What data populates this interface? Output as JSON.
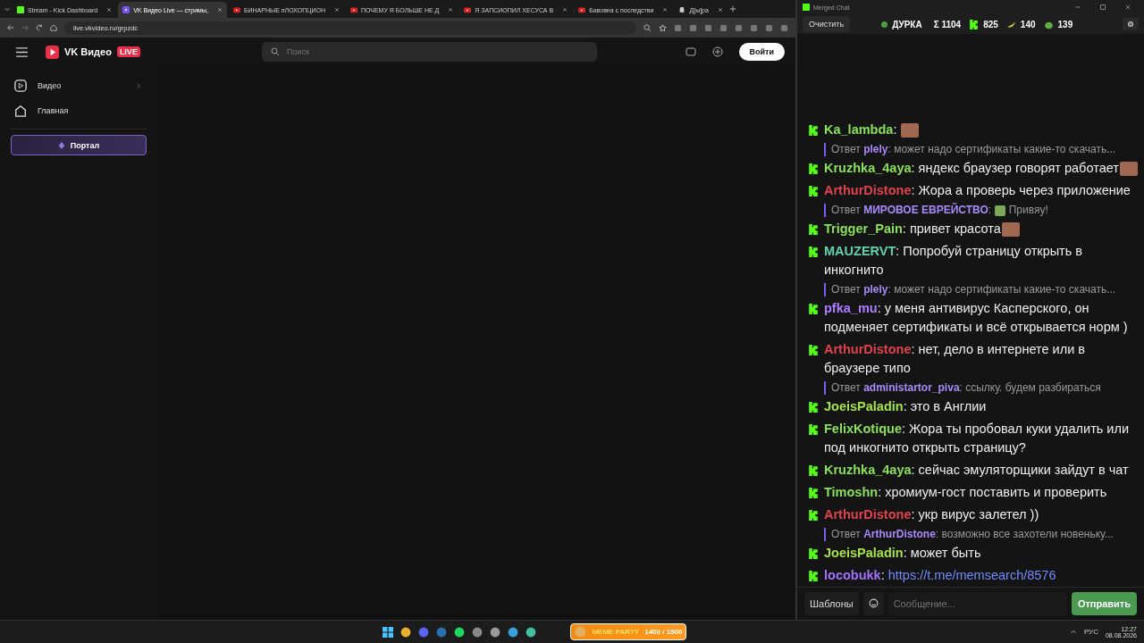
{
  "browser": {
    "tabs": [
      {
        "kind": "kick",
        "title": "Stream - Kick Dashboard",
        "selected": false
      },
      {
        "kind": "vk",
        "title": "VK Видео Live — стримы, ",
        "selected": true
      },
      {
        "kind": "youtube",
        "title": "БИНАРНЫЕ пЛОХОПЦИОН",
        "selected": false
      },
      {
        "kind": "youtube",
        "title": "ПОЧЕМУ Я БОЛЬШЕ НЕ Д",
        "selected": false
      },
      {
        "kind": "youtube",
        "title": "Я ЗАПСИОПИЛ ХЕСУСА В",
        "selected": false
      },
      {
        "kind": "youtube",
        "title": "Бавовна с последстви",
        "selected": false
      },
      {
        "kind": "ghost",
        "title": "Д[ы]ра",
        "selected": false
      }
    ],
    "url": "live.vkvideo.ru/grpzdc"
  },
  "site": {
    "logo_text": "VK Видео",
    "logo_badge": "LIVE",
    "search": {
      "placeholder": "Поиск"
    },
    "login": "Войти",
    "nav": [
      {
        "kind": "video",
        "label": "Видео",
        "expandable": true
      },
      {
        "kind": "home",
        "label": "Главная",
        "expandable": false
      }
    ],
    "portal": "Портал"
  },
  "chat": {
    "window_title": "Merged Chat",
    "clear": "Очистить",
    "channel": "ДУРКА",
    "stats": [
      {
        "kind": "sum",
        "value": "Σ 1104"
      },
      {
        "kind": "kick",
        "value": "825"
      },
      {
        "kind": "banana",
        "value": "140"
      },
      {
        "kind": "frog",
        "value": "139"
      }
    ],
    "messages": [
      {
        "kind": "message",
        "user": "Ka_lambda",
        "sep": ":",
        "color": "#8be05a",
        "emote": true
      },
      {
        "kind": "reply",
        "label": "Ответ",
        "user": "plely",
        "sep": ":",
        "color": "#a78bfa",
        "text": "может надо сертификаты какие-то скачать...",
        "emote": false
      },
      {
        "kind": "message",
        "user": "Kruzhka_4aya",
        "sep": ":",
        "color": "#8be05a",
        "text": "яндекс браузер говорят работает",
        "emote": true
      },
      {
        "kind": "message",
        "user": "ArthurDistone",
        "sep": ":",
        "color": "#e0434d",
        "text": "Жора а проверь через приложение",
        "emote": false
      },
      {
        "kind": "reply",
        "label": "Ответ",
        "user": "МИРОВОЕ ЕВРЕЙСТВО",
        "sep": ":",
        "color": "#a78bfa",
        "text": "Привяу!",
        "emote": true
      },
      {
        "kind": "message",
        "user": "Trigger_Pain",
        "sep": ":",
        "color": "#8be05a",
        "text": "привет красота",
        "emote": true
      },
      {
        "kind": "message",
        "user": "MAUZERVT",
        "sep": ":",
        "color": "#62cfae",
        "text": "Попробуй страницу открыть в инкогнито",
        "emote": false
      },
      {
        "kind": "reply",
        "label": "Ответ",
        "user": "plely",
        "sep": ":",
        "color": "#a78bfa",
        "text": "может надо сертификаты какие-то скачать...",
        "emote": false
      },
      {
        "kind": "message",
        "user": "pfka_mu",
        "sep": ":",
        "color": "#b07cff",
        "text": "у меня антивирус Касперского, он подменяет сертификаты и всё открывается норм )",
        "emote": false
      },
      {
        "kind": "message",
        "user": "ArthurDistone",
        "sep": ":",
        "color": "#e0434d",
        "text": "нет, дело в интернете или в браузере типо",
        "emote": false
      },
      {
        "kind": "reply",
        "label": "Ответ",
        "user": "administartor_piva",
        "sep": ":",
        "color": "#a78bfa",
        "text": "ссылку. будем разбираться",
        "emote": false
      },
      {
        "kind": "message",
        "user": "JoeisPaladin",
        "sep": ":",
        "color": "#a6e04e",
        "text": "это в Англии",
        "emote": false
      },
      {
        "kind": "message",
        "user": "FelixKotique",
        "sep": ":",
        "color": "#8be05a",
        "text": "Жора ты пробовал куки удалить или под инкогнито открыть страницу?",
        "emote": false
      },
      {
        "kind": "message",
        "user": "Kruzhka_4aya",
        "sep": ":",
        "color": "#8be05a",
        "text": "сейчас эмуляторщики зайдут в чат",
        "emote": false
      },
      {
        "kind": "message",
        "user": "Timoshn",
        "sep": ":",
        "color": "#8be05a",
        "text": "хромиум-гост поставить и проверить",
        "emote": false
      },
      {
        "kind": "message",
        "user": "ArthurDistone",
        "sep": ":",
        "color": "#e0434d",
        "text": "укр вирус залетел ))",
        "emote": false
      },
      {
        "kind": "reply",
        "label": "Ответ",
        "user": "ArthurDistone",
        "sep": ":",
        "color": "#a78bfa",
        "text": "возможно все захотели новеньку...",
        "emote": false
      },
      {
        "kind": "message",
        "user": "JoeisPaladin",
        "sep": ":",
        "color": "#a6e04e",
        "text": "может быть",
        "emote": false
      },
      {
        "kind": "link",
        "user": "locobukk",
        "sep": ":",
        "color": "#a070ff",
        "text": "https://t.me/memsearch/8576",
        "emote": false
      }
    ],
    "templates": "Шаблоны",
    "input": {
      "placeholder": "Сообщение..."
    },
    "send": "Отправить"
  },
  "taskbar": {
    "widget_title": "MEME PARTY",
    "widget_value": "1400 / 1500",
    "language": "РУС",
    "time": "12:27",
    "date": "08.08.2026"
  }
}
